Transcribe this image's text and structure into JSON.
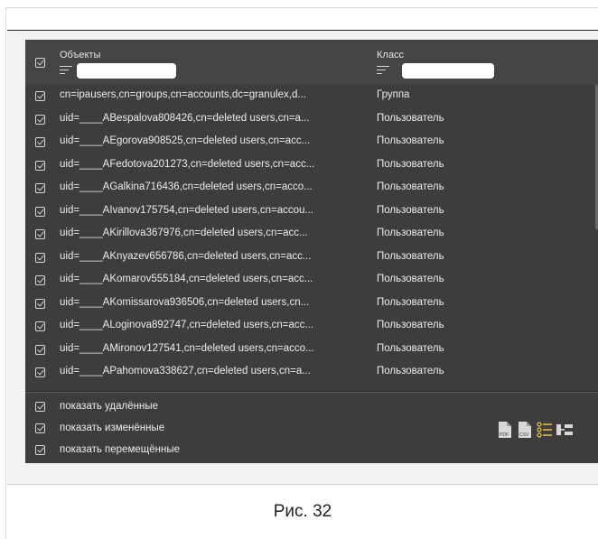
{
  "header": {
    "col_object": "Объекты",
    "col_class": "Класс"
  },
  "rows": [
    {
      "object": "cn=ipausers,cn=groups,cn=accounts,dc=granulex,d...",
      "class": "Группа"
    },
    {
      "object": "uid=____ABespalova808426,cn=deleted users,cn=a...",
      "class": "Пользователь"
    },
    {
      "object": "uid=____AEgorova908525,cn=deleted users,cn=acc...",
      "class": "Пользователь"
    },
    {
      "object": "uid=____AFedotova201273,cn=deleted users,cn=acc...",
      "class": "Пользователь"
    },
    {
      "object": "uid=____AGalkina716436,cn=deleted users,cn=acco...",
      "class": "Пользователь"
    },
    {
      "object": "uid=____AIvanov175754,cn=deleted users,cn=accou...",
      "class": "Пользователь"
    },
    {
      "object": "uid=____AKirillova367976,cn=deleted users,cn=acc...",
      "class": "Пользователь"
    },
    {
      "object": "uid=____AKnyazev656786,cn=deleted users,cn=acc...",
      "class": "Пользователь"
    },
    {
      "object": "uid=____AKomarov555184,cn=deleted users,cn=acc...",
      "class": "Пользователь"
    },
    {
      "object": "uid=____AKomissarova936506,cn=deleted users,cn...",
      "class": "Пользователь"
    },
    {
      "object": "uid=____ALoginova892747,cn=deleted users,cn=acc...",
      "class": "Пользователь"
    },
    {
      "object": "uid=____AMironov127541,cn=deleted users,cn=acco...",
      "class": "Пользователь"
    },
    {
      "object": "uid=____APahomova338627,cn=deleted users,cn=a...",
      "class": "Пользователь"
    }
  ],
  "options": [
    {
      "label": "показать удалённые"
    },
    {
      "label": "показать изменённые"
    },
    {
      "label": "показать перемещённые"
    }
  ],
  "toolbar": {
    "pdf_label": "PDF",
    "csv_label": "CSV",
    "list_icon": "list-icon",
    "tree_icon": "tree-icon",
    "accent": "#e8c24a"
  },
  "caption": "Рис. 32"
}
